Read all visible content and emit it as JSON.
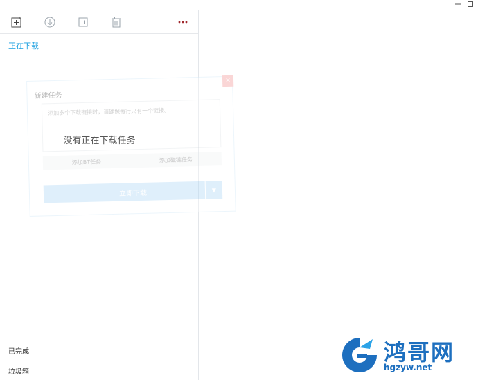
{
  "toolbar": {
    "new_task_icon": "plus-square-icon",
    "start_icon": "download-circle-icon",
    "pause_icon": "pause-icon",
    "delete_icon": "trash-icon",
    "more_icon": "more-icon"
  },
  "section": {
    "downloading_title": "正在下载"
  },
  "empty": {
    "message": "没有正在下载任务"
  },
  "ghost_dialog": {
    "title": "新建任务",
    "input_placeholder": "添加多个下载链接时，请确保每行只有一个链接。",
    "add_bt": "添加BT任务",
    "add_magnet": "添加磁链任务",
    "download_now": "立即下载"
  },
  "nav": {
    "completed": "已完成",
    "trash": "垃圾箱"
  },
  "watermark": {
    "name": "鸿哥网",
    "url": "hgzyw.net"
  },
  "colors": {
    "accent": "#1a9fe0",
    "icon_gray": "#9aa3ab",
    "more_red": "#a0282d",
    "watermark_blue": "#1d6fbf"
  }
}
